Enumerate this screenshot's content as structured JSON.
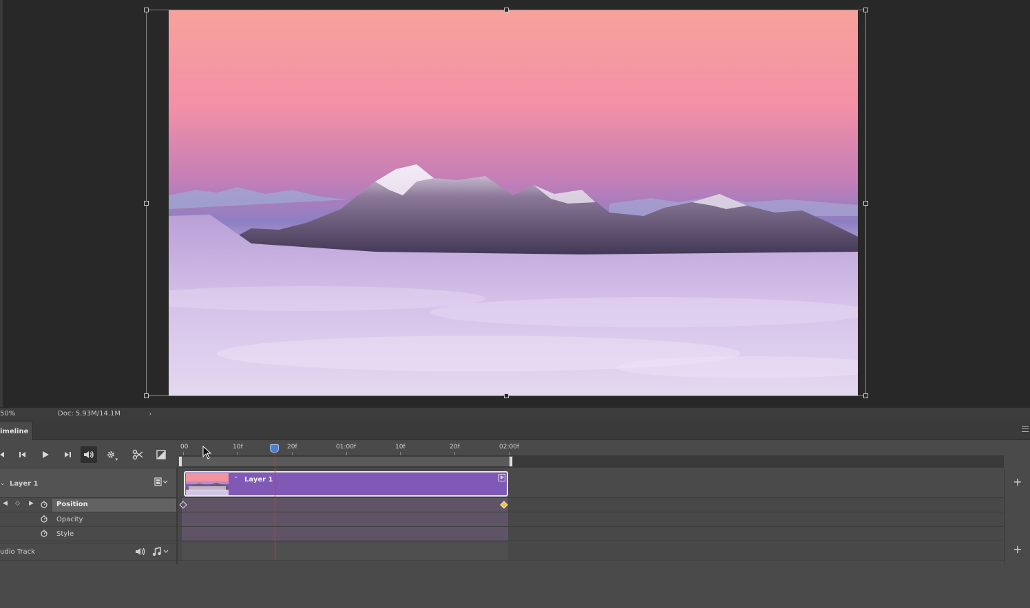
{
  "status_bar": {
    "zoom": "50%",
    "doc_info": "Doc: 5.93M/14.1M",
    "arrow": "›"
  },
  "panel": {
    "tab_label": "imeline"
  },
  "controls": {
    "icons": [
      "go-to-first-frame-icon",
      "step-back-icon",
      "play-icon",
      "step-forward-icon",
      "audio-icon",
      "settings-icon",
      "split-at-playhead-icon",
      "transition-icon"
    ]
  },
  "ruler": {
    "labels": [
      "00",
      "10f",
      "20f",
      "01:00f",
      "10f",
      "20f",
      "02:00f"
    ]
  },
  "layers": {
    "layer1_name": "Layer 1",
    "clip_label": "Layer 1",
    "properties": [
      "Position",
      "Opacity",
      "Style"
    ],
    "audio_track_label": "udio Track"
  },
  "colors": {
    "clip_purple": "#7f59b5",
    "playhead_blue": "#4b7fd6",
    "playhead_red": "#e03030",
    "keyframe_yellow": "#e8c245"
  }
}
